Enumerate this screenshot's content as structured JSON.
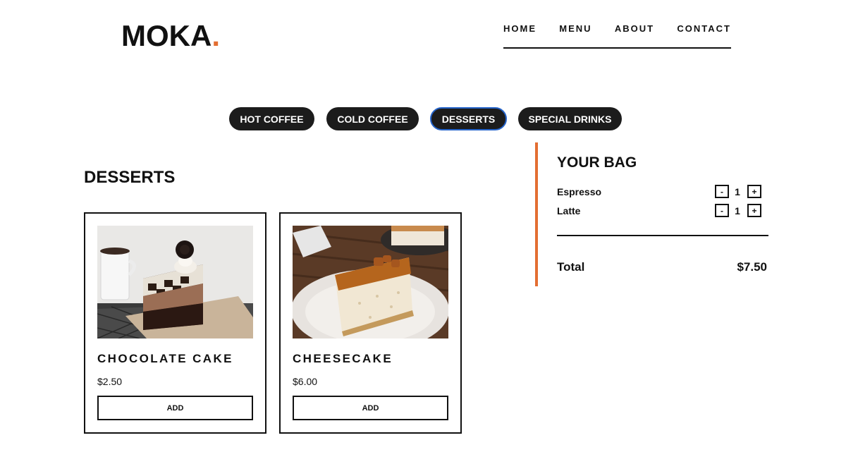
{
  "brand": {
    "name": "MOKA",
    "dot": ".",
    "accent_color": "#e36e32"
  },
  "nav": [
    {
      "label": "HOME"
    },
    {
      "label": "MENU"
    },
    {
      "label": "ABOUT"
    },
    {
      "label": "CONTACT"
    }
  ],
  "categories": [
    {
      "label": "HOT COFFEE",
      "active": false
    },
    {
      "label": "COLD COFFEE",
      "active": false
    },
    {
      "label": "DESSERTS",
      "active": true
    },
    {
      "label": "SPECIAL DRINKS",
      "active": false
    }
  ],
  "section": {
    "title": "DESSERTS"
  },
  "products": [
    {
      "name": "CHOCOLATE CAKE",
      "price": "$2.50",
      "button": "ADD",
      "image": "chocolate-cake-slice-photo"
    },
    {
      "name": "CHEESECAKE",
      "price": "$6.00",
      "button": "ADD",
      "image": "cheesecake-slice-photo"
    }
  ],
  "bag": {
    "title": "YOUR BAG",
    "items": [
      {
        "name": "Espresso",
        "qty": "1",
        "minus": "-",
        "plus": "+"
      },
      {
        "name": "Latte",
        "qty": "1",
        "minus": "-",
        "plus": "+"
      }
    ],
    "total_label": "Total",
    "total_value": "$7.50"
  },
  "colors": {
    "pill_bg": "#1c1c1c",
    "active_outline": "#2463c9",
    "text": "#111111"
  }
}
